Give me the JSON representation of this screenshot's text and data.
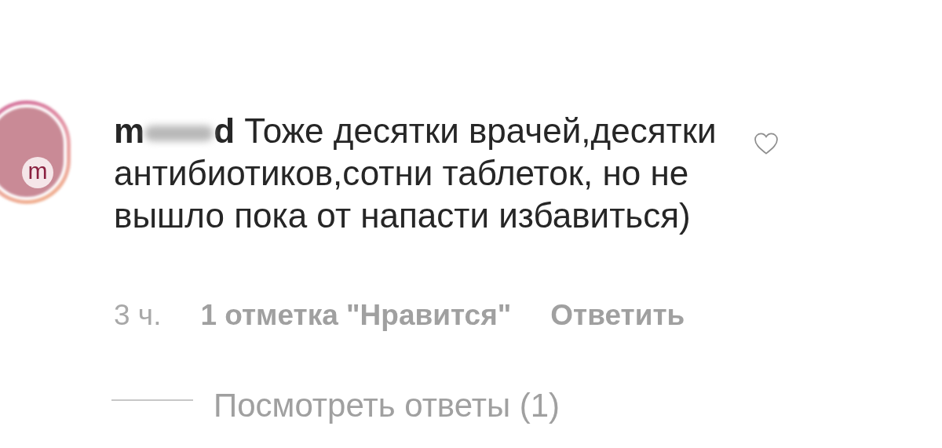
{
  "avatar": {
    "letter": "m"
  },
  "comment": {
    "username_start": "m",
    "username_end": "d",
    "text": "Тоже десятки врачей,десятки антибиотиков,сотни таблеток, но не вышло пока от напасти избавиться)",
    "liked": false
  },
  "meta": {
    "time": "3 ч.",
    "likes": "1 отметка \"Нравится\"",
    "reply": "Ответить"
  },
  "view_replies": "Посмотреть ответы (1)"
}
